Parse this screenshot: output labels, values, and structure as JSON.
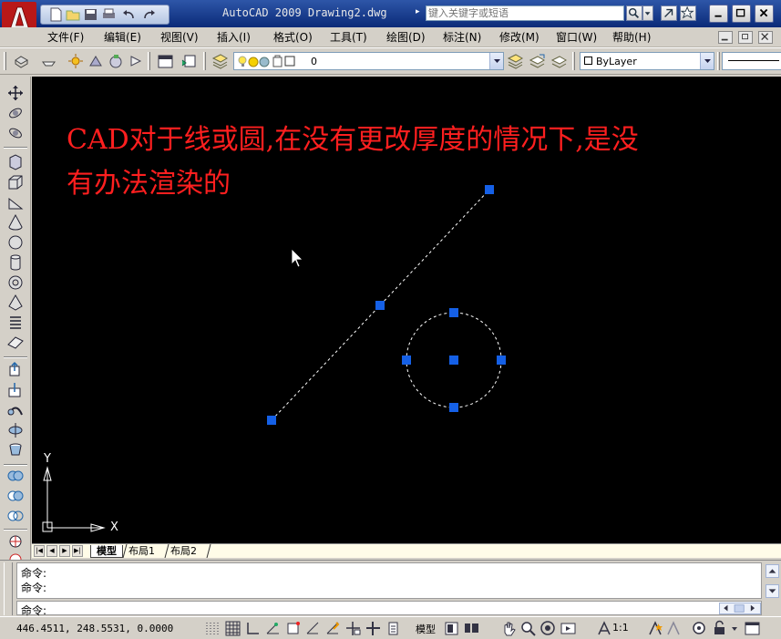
{
  "app": {
    "title": "AutoCAD 2009 Drawing2.dwg",
    "search_placeholder": "键入关键字或短语"
  },
  "menu": {
    "items": [
      "文件(F)",
      "编辑(E)",
      "视图(V)",
      "插入(I)",
      "格式(O)",
      "工具(T)",
      "绘图(D)",
      "标注(N)",
      "修改(M)",
      "窗口(W)",
      "帮助(H)"
    ]
  },
  "toolbar": {
    "layer_value": "0",
    "color_value": "ByLayer"
  },
  "canvas": {
    "annotation_line1": "CAD对于线或圆,在没有更改厚度的情况下,是没",
    "annotation_line2": "有办法渲染的",
    "ucs_x_label": "X",
    "ucs_y_label": "Y",
    "annotation_color": "#ff1f1f",
    "grip_color": "#1560e6"
  },
  "layout_tabs": [
    "模型",
    "布局1",
    "布局2"
  ],
  "command": {
    "history": [
      "命令:",
      "命令:"
    ],
    "prompt": "命令:"
  },
  "status": {
    "coordinates": "446.4511, 248.5531, 0.0000",
    "model_label": "模型",
    "annotation_scale": "1:1"
  }
}
